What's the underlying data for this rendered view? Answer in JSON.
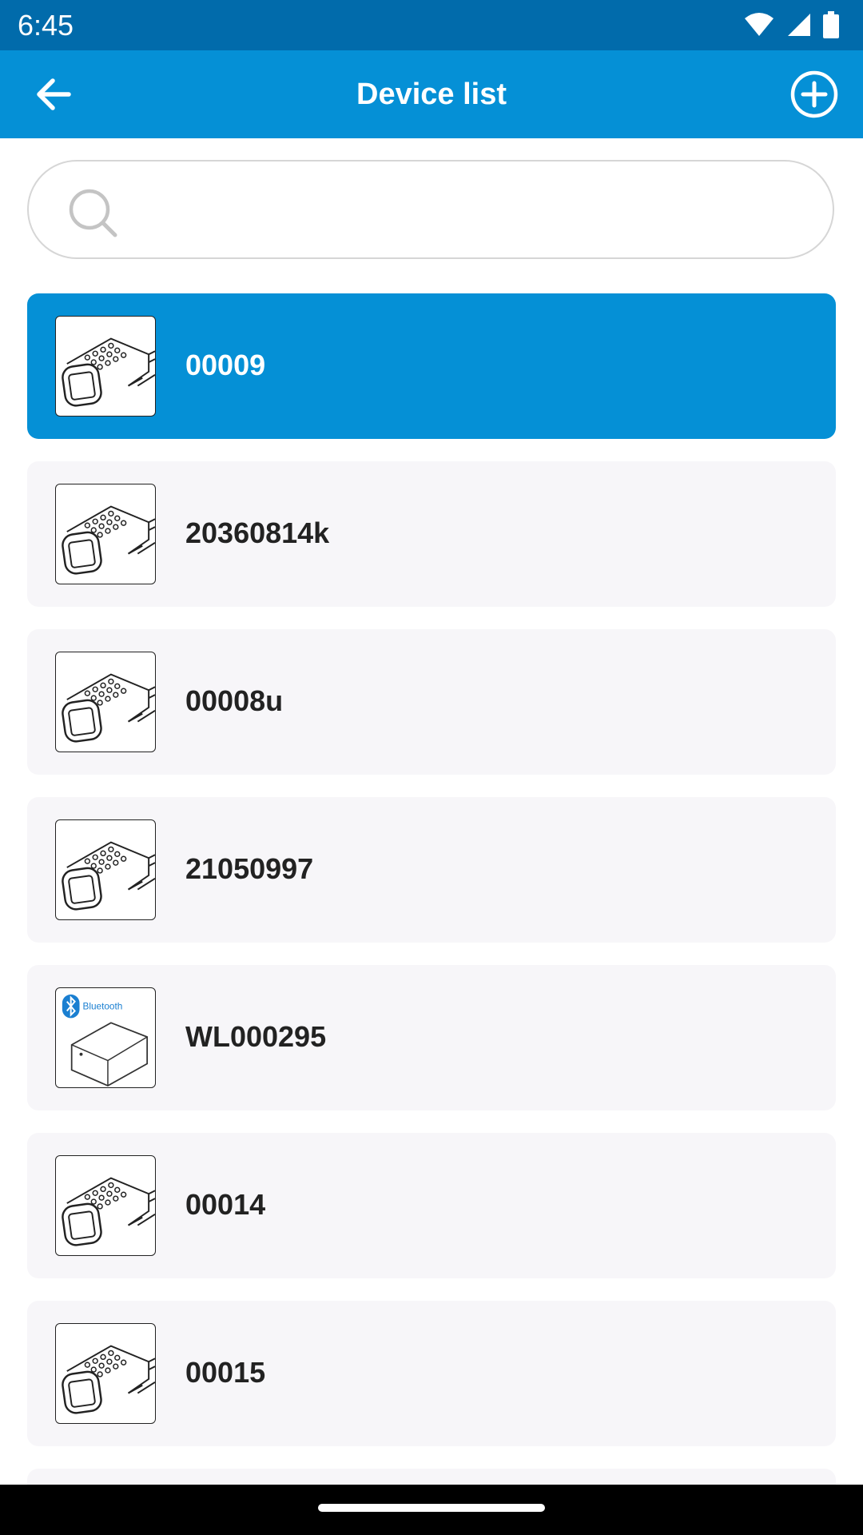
{
  "status": {
    "time": "6:45",
    "icons": [
      "wifi-icon",
      "signal-icon",
      "battery-icon"
    ]
  },
  "header": {
    "title": "Device list",
    "back_icon": "arrow-left-icon",
    "add_icon": "plus-circle-icon"
  },
  "search": {
    "placeholder": "",
    "value": "",
    "icon": "search-icon"
  },
  "devices": [
    {
      "name": "00009",
      "image": "keypad-lock",
      "selected": true
    },
    {
      "name": "20360814k",
      "image": "keypad-lock",
      "selected": false
    },
    {
      "name": "00008u",
      "image": "keypad-lock",
      "selected": false
    },
    {
      "name": "21050997",
      "image": "keypad-lock",
      "selected": false
    },
    {
      "name": "WL000295",
      "image": "bluetooth-gateway",
      "badge_text": "Bluetooth",
      "selected": false
    },
    {
      "name": "00014",
      "image": "keypad-lock",
      "selected": false
    },
    {
      "name": "00015",
      "image": "keypad-lock",
      "selected": false
    }
  ],
  "colors": {
    "status_bar": "#016bab",
    "app_bar": "#0590d6",
    "selected_item": "#0590d6",
    "item_bg": "#f7f6f9"
  }
}
